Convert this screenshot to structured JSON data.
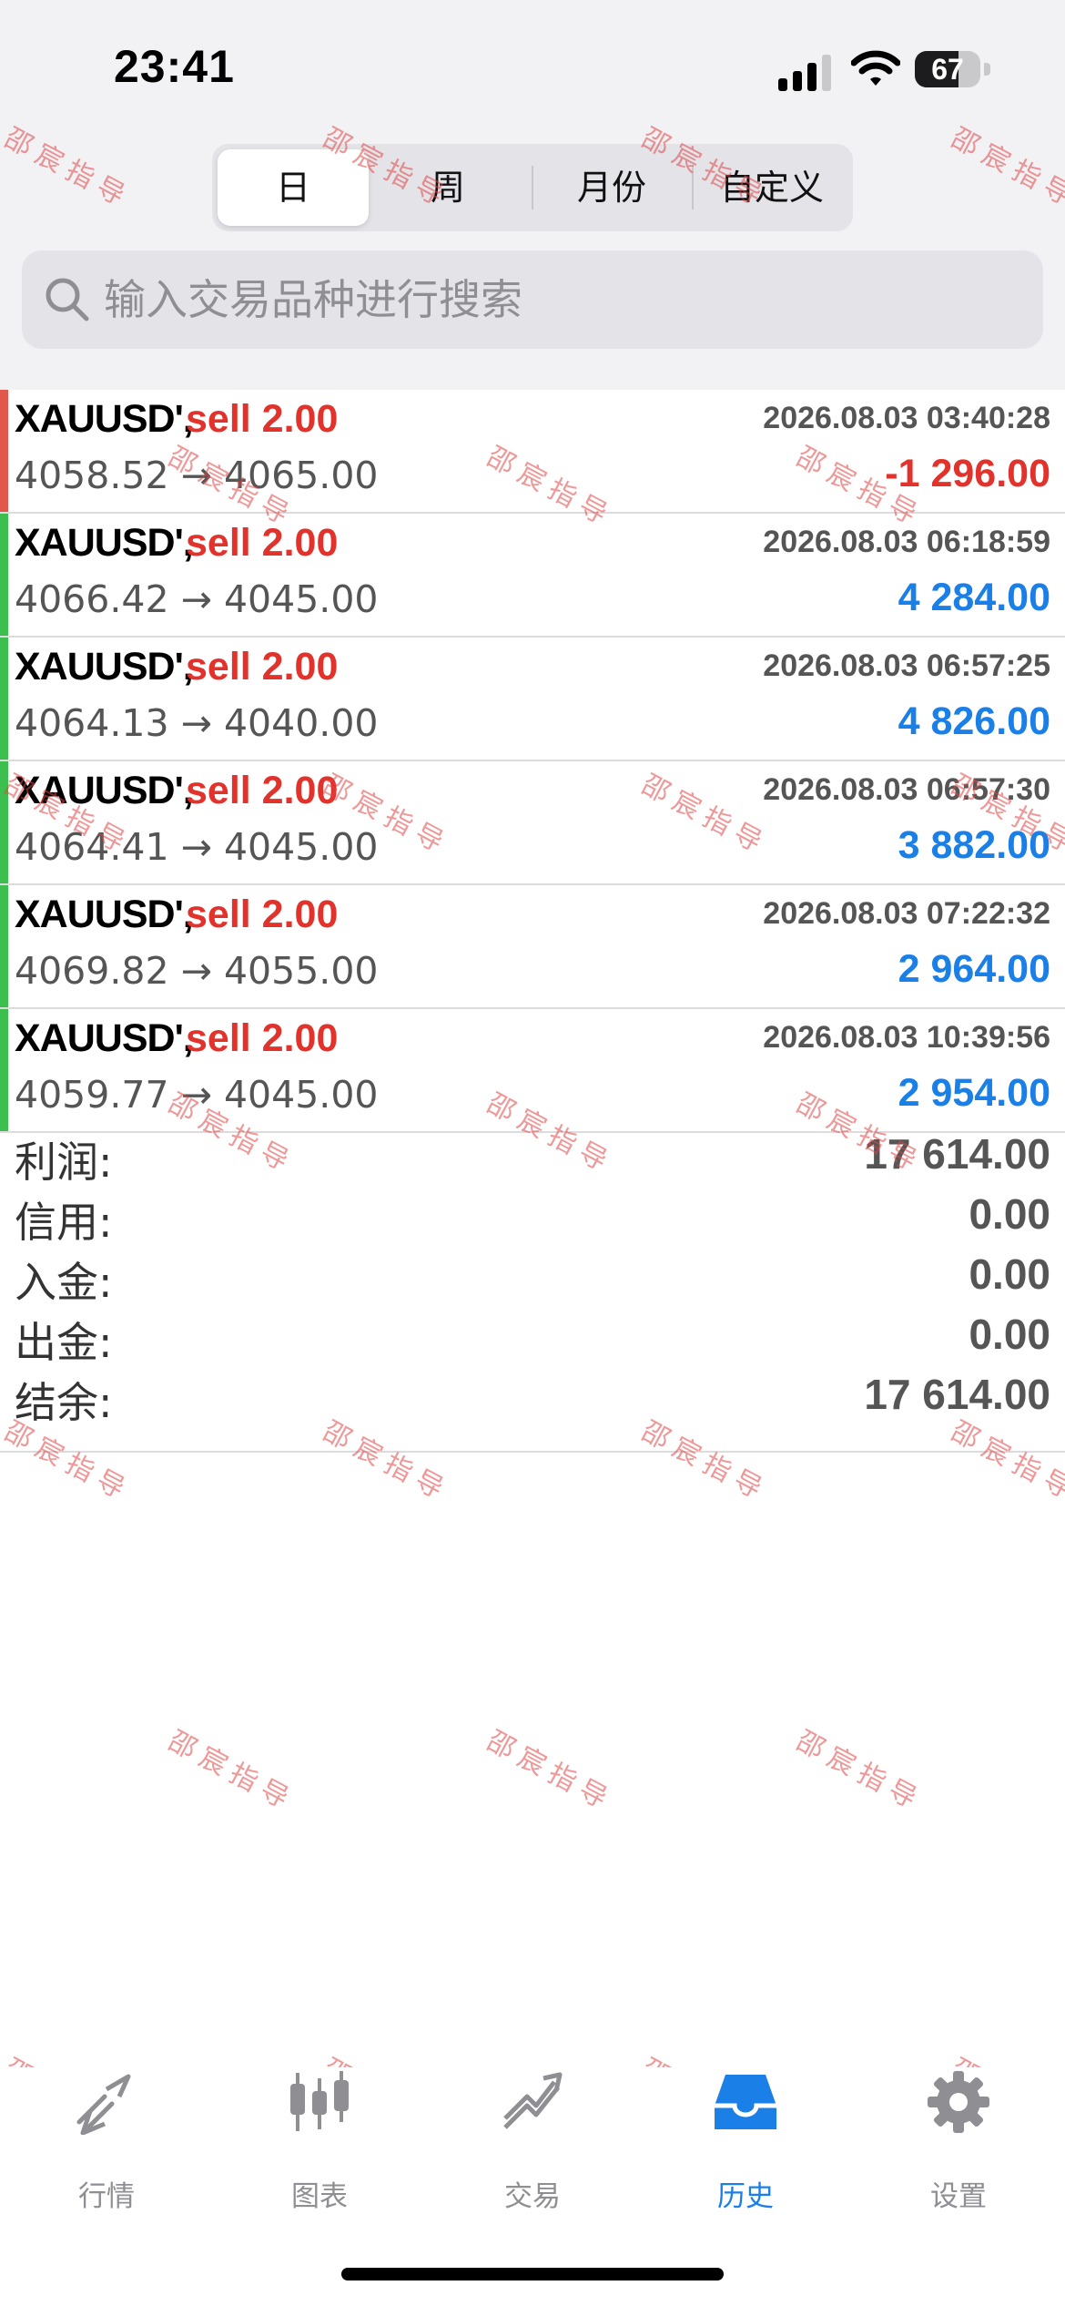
{
  "status_bar": {
    "time": "23:41",
    "battery": "67"
  },
  "period_tabs": [
    {
      "label": "日",
      "active": true
    },
    {
      "label": "周",
      "active": false
    },
    {
      "label": "月份",
      "active": false
    },
    {
      "label": "自定义",
      "active": false
    }
  ],
  "search": {
    "placeholder": "输入交易品种进行搜索",
    "value": "",
    "icon": "search-icon"
  },
  "trades": [
    {
      "symbol": "XAUUSD',",
      "side": "sell 2.00",
      "time": "2026.08.03 03:40:28",
      "prices": "4058.52 → 4065.00",
      "profit": "-1 296.00",
      "result": "loss",
      "bar_color": "#e2574c"
    },
    {
      "symbol": "XAUUSD',",
      "side": "sell 2.00",
      "time": "2026.08.03 06:18:59",
      "prices": "4066.42 → 4045.00",
      "profit": "4 284.00",
      "result": "profit",
      "bar_color": "#3cbf4e"
    },
    {
      "symbol": "XAUUSD',",
      "side": "sell 2.00",
      "time": "2026.08.03 06:57:25",
      "prices": "4064.13 → 4040.00",
      "profit": "4 826.00",
      "result": "profit",
      "bar_color": "#3cbf4e"
    },
    {
      "symbol": "XAUUSD',",
      "side": "sell 2.00",
      "time": "2026.08.03 06:57:30",
      "prices": "4064.41 → 4045.00",
      "profit": "3 882.00",
      "result": "profit",
      "bar_color": "#3cbf4e"
    },
    {
      "symbol": "XAUUSD',",
      "side": "sell 2.00",
      "time": "2026.08.03 07:22:32",
      "prices": "4069.82 → 4055.00",
      "profit": "2 964.00",
      "result": "profit",
      "bar_color": "#3cbf4e"
    },
    {
      "symbol": "XAUUSD',",
      "side": "sell 2.00",
      "time": "2026.08.03 10:39:56",
      "prices": "4059.77 → 4045.00",
      "profit": "2 954.00",
      "result": "profit",
      "bar_color": "#3cbf4e"
    }
  ],
  "summary": [
    {
      "label": "利润:",
      "value": "17 614.00"
    },
    {
      "label": "信用:",
      "value": "0.00"
    },
    {
      "label": "入金:",
      "value": "0.00"
    },
    {
      "label": "出金:",
      "value": "0.00"
    },
    {
      "label": "结余:",
      "value": "17 614.00"
    }
  ],
  "watermark": "邵宸指导",
  "tab_bar": [
    {
      "label": "行情",
      "icon": "quotes-icon",
      "active": false
    },
    {
      "label": "图表",
      "icon": "candlestick-chart-icon",
      "active": false
    },
    {
      "label": "交易",
      "icon": "trade-trend-icon",
      "active": false
    },
    {
      "label": "历史",
      "icon": "history-inbox-icon",
      "active": true
    },
    {
      "label": "设置",
      "icon": "gear-icon",
      "active": false
    }
  ],
  "colors": {
    "accent": "#1a7fe6",
    "loss": "#e2322c",
    "profit_bar": "#3cbf4e",
    "loss_bar": "#e2574c"
  }
}
